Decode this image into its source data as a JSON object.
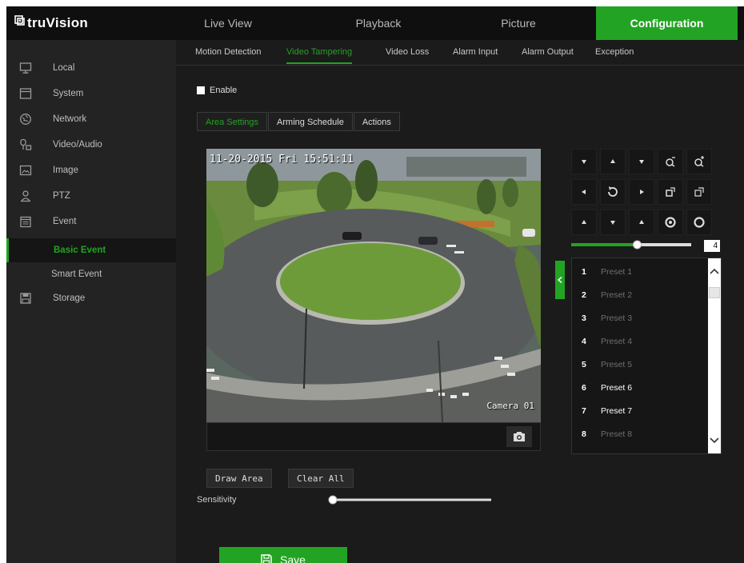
{
  "brand": {
    "name": "truVision"
  },
  "nav": {
    "tabs": [
      {
        "label": "Live View"
      },
      {
        "label": "Playback"
      },
      {
        "label": "Picture"
      },
      {
        "label": "Configuration",
        "active": true
      }
    ]
  },
  "sidebar": {
    "items": [
      {
        "label": "Local",
        "icon": "monitor-icon"
      },
      {
        "label": "System",
        "icon": "window-icon"
      },
      {
        "label": "Network",
        "icon": "globe-icon"
      },
      {
        "label": "Video/Audio",
        "icon": "video-audio-icon"
      },
      {
        "label": "Image",
        "icon": "image-icon"
      },
      {
        "label": "PTZ",
        "icon": "person-icon"
      },
      {
        "label": "Event",
        "icon": "calendar-icon"
      },
      {
        "label": "Basic Event",
        "sub": true,
        "active": true
      },
      {
        "label": "Smart Event",
        "sub": true
      },
      {
        "label": "Storage",
        "icon": "disk-icon"
      }
    ]
  },
  "subtabs": [
    {
      "label": "Motion Detection"
    },
    {
      "label": "Video Tampering",
      "active": true
    },
    {
      "label": "Video Loss"
    },
    {
      "label": "Alarm Input"
    },
    {
      "label": "Alarm Output"
    },
    {
      "label": "Exception"
    }
  ],
  "enable": {
    "label": "Enable",
    "checked": false
  },
  "steps": [
    {
      "label": "Area Settings",
      "active": true
    },
    {
      "label": "Arming Schedule"
    },
    {
      "label": "Actions"
    }
  ],
  "video": {
    "timestamp": "11-20-2015 Fri 15:51:11",
    "camera_label": "Camera 01"
  },
  "ptz": {
    "speed_value": "4",
    "speed_level": 0.55
  },
  "presets": [
    {
      "num": "1",
      "label": "Preset 1",
      "set": false
    },
    {
      "num": "2",
      "label": "Preset 2",
      "set": false
    },
    {
      "num": "3",
      "label": "Preset 3",
      "set": false
    },
    {
      "num": "4",
      "label": "Preset 4",
      "set": false
    },
    {
      "num": "5",
      "label": "Preset 5",
      "set": false
    },
    {
      "num": "6",
      "label": "Preset 6",
      "set": true
    },
    {
      "num": "7",
      "label": "Preset 7",
      "set": true
    },
    {
      "num": "8",
      "label": "Preset 8",
      "set": false
    }
  ],
  "buttons": {
    "draw_area": "Draw Area",
    "clear_all": "Clear All",
    "save": "Save"
  },
  "sensitivity": {
    "label": "Sensitivity",
    "level": 0.0
  },
  "colors": {
    "accent": "#23a323",
    "background": "#1b1b1b",
    "sidebar": "#232323"
  }
}
